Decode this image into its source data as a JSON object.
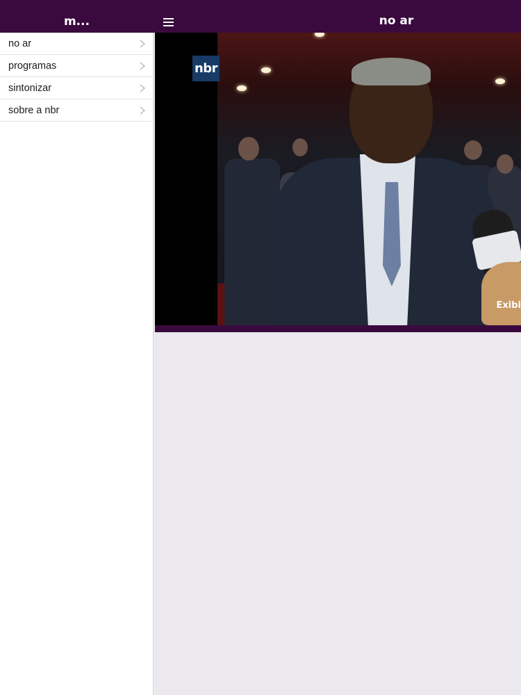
{
  "sidebar": {
    "title": "m...",
    "items": [
      {
        "label": "no ar"
      },
      {
        "label": "programas"
      },
      {
        "label": "sintonizar"
      },
      {
        "label": "sobre a nbr"
      }
    ]
  },
  "header": {
    "title": "no ar",
    "menu_icon": "hamburger-icon"
  },
  "video": {
    "logo_text": "nbr",
    "caption": "Exibi"
  },
  "colors": {
    "brand": "#3a0a3f",
    "content_bg": "#ebe9ee",
    "logo_bg": "#173b66"
  }
}
